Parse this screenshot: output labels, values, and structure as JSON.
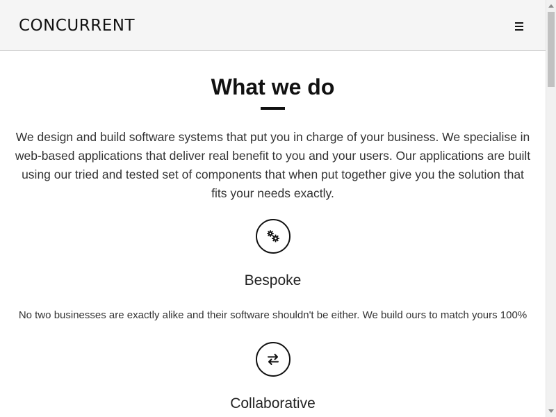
{
  "header": {
    "logo_text": "CONCURRENT",
    "menu_icon": "hamburger-menu-icon"
  },
  "section": {
    "title": "What we do",
    "intro": "We design and build software systems that put you in charge of your business. We specialise in web-based applications that deliver real benefit to you and your users. Our applications are built using our tried and tested set of components that when put together give you the solution that fits your needs exactly."
  },
  "features": [
    {
      "icon": "gears-icon",
      "title": "Bespoke",
      "description": "No two businesses are exactly alike and their software shouldn't be either. We build ours to match yours 100%"
    },
    {
      "icon": "exchange-arrows-icon",
      "title": "Collaborative"
    }
  ],
  "colors": {
    "header_background": "#f5f5f5",
    "text_dark": "#111111",
    "text_body": "#333333",
    "scrollbar_track": "#f1f1f1",
    "scrollbar_thumb": "#c1c1c1"
  }
}
